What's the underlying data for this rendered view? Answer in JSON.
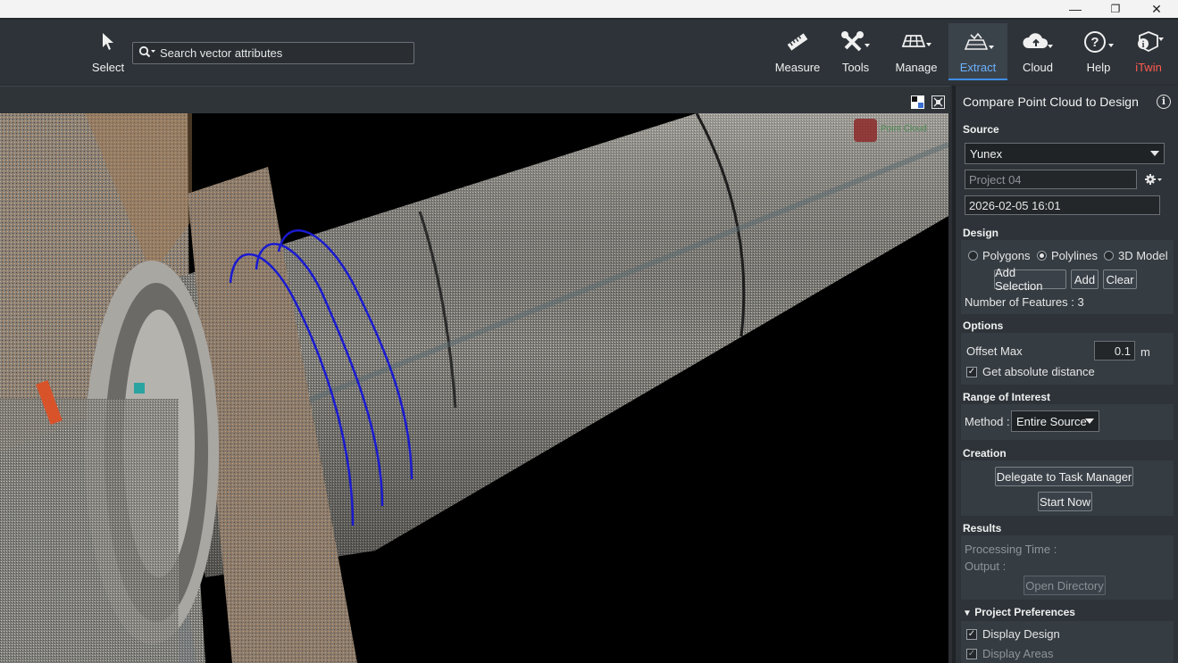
{
  "window": {
    "minimize": "—",
    "maximize": "❐",
    "close": "✕"
  },
  "toolbar": {
    "select_label": "Select",
    "search_placeholder": "Search vector attributes",
    "items": [
      {
        "label": "Measure",
        "icon": "ruler-icon"
      },
      {
        "label": "Tools",
        "icon": "tools-icon"
      },
      {
        "label": "Manage",
        "icon": "grid-plane-icon"
      },
      {
        "label": "Extract",
        "icon": "extract-icon",
        "active": true
      },
      {
        "label": "Cloud",
        "icon": "cloud-upload-icon"
      },
      {
        "label": "Help",
        "icon": "help-icon"
      },
      {
        "label": "iTwin",
        "icon": "itwin-icon"
      }
    ]
  },
  "panel": {
    "title": "Compare Point Cloud to Design",
    "source": {
      "heading": "Source",
      "selected": "Yunex",
      "project": "Project 04",
      "timestamp": "2026-02-05 16:01"
    },
    "design": {
      "heading": "Design",
      "options": [
        "Polygons",
        "Polylines",
        "3D Model"
      ],
      "selected": "Polylines",
      "add_selection": "Add Selection",
      "add": "Add",
      "clear": "Clear",
      "feature_count": "Number of Features : 3"
    },
    "options": {
      "heading": "Options",
      "offset_label": "Offset Max",
      "offset_value": "0.1",
      "offset_unit": "m",
      "absolute_label": "Get absolute distance",
      "absolute_checked": true
    },
    "range": {
      "heading": "Range of Interest",
      "method_label": "Method :",
      "method_value": "Entire Source"
    },
    "creation": {
      "heading": "Creation",
      "delegate": "Delegate to Task Manager",
      "start": "Start Now"
    },
    "results": {
      "heading": "Results",
      "processing": "Processing Time :",
      "output": "Output :",
      "open_dir": "Open Directory"
    },
    "prefs": {
      "heading": "Project Preferences",
      "display_design": "Display Design",
      "display_areas": "Display Areas"
    }
  },
  "viewport": {
    "watermark": "Point Cloud"
  }
}
